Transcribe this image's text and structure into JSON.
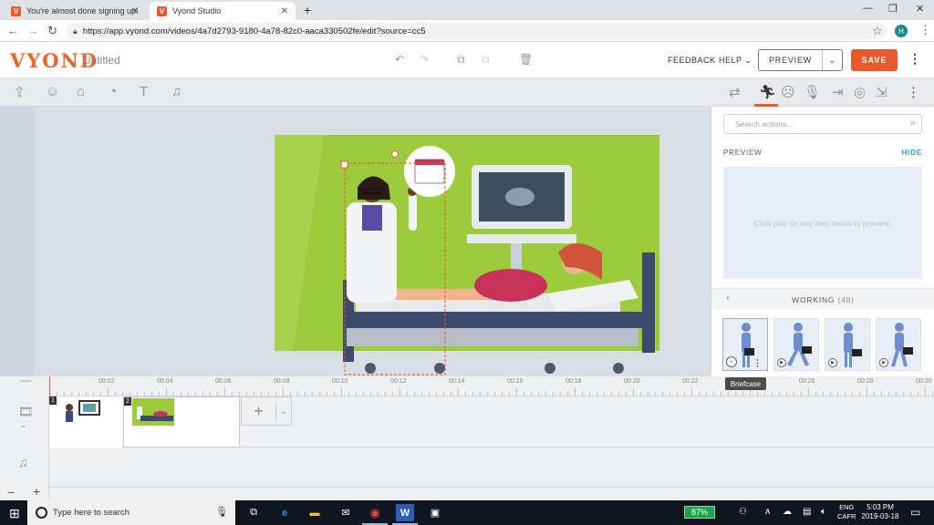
{
  "browser": {
    "tabs": [
      {
        "title": "You're almost done signing up!",
        "favicon": "V"
      },
      {
        "title": "Vyond Studio",
        "favicon": "V"
      }
    ],
    "url": "https://app.vyond.com/videos/4a7d2793-9180-4a78-82c0-aaca330502fe/edit?source=cc5",
    "profile_initial": "H"
  },
  "app": {
    "logo": "VYOND",
    "title": "Untitled",
    "feedback": "FEEDBACK",
    "help": "HELP",
    "preview": "PREVIEW",
    "save": "SAVE"
  },
  "panel": {
    "search_placeholder": "Search actions...",
    "preview_label": "PREVIEW",
    "hide_label": "HIDE",
    "preview_hint": "Click play on any item below to preview.",
    "category": "WORKING",
    "category_count": "(48)",
    "tooltip": "Briefcase"
  },
  "timeline": {
    "ticks": [
      "00:02",
      "00:04",
      "00:06",
      "00:08",
      "00:10",
      "00:12",
      "00:14",
      "00:16",
      "00:18",
      "00:20",
      "00:22",
      "00:24",
      "00:26",
      "00:28",
      "00:30"
    ],
    "scenes": [
      "1",
      "2"
    ]
  },
  "taskbar": {
    "search_placeholder": "Type here to search",
    "battery": "87%",
    "lang1": "ENG",
    "lang2": "CAFR",
    "time": "5:03 PM",
    "date": "2019-03-18"
  },
  "colors": {
    "brand": "#e65a2e",
    "accent": "#2b9ab7",
    "scene_bg": "#9ccc3d"
  }
}
